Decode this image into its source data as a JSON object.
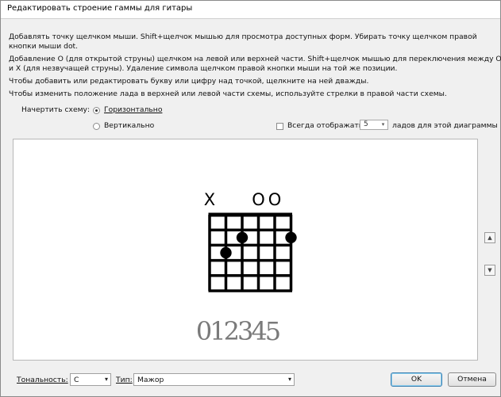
{
  "window": {
    "title": "Редактировать строение гаммы для гитары"
  },
  "instructions": [
    "Добавлять точку щелчком мыши. Shift+щелчок мышью для просмотра доступных форм. Убирать точку щелчком правой",
    "кнопки мыши dot.",
    "Добавление O (для открытой струны) щелчком на левой или верхней части. Shift+щелчок мышью для переключения между O",
    "и X (для незвучащей струны). Удаление символа щелчком правой кнопки мыши на той же позиции.",
    "Чтобы добавить или редактировать букву или цифру над точкой, щелкните на ней дважды.",
    "Чтобы изменить положение лада в верхней или левой части схемы, используйте стрелки в правой части схемы."
  ],
  "orientation": {
    "label": "Начертить схему:",
    "horizontal": "Горизонтально",
    "vertical": "Вертикально",
    "selected": "horizontal"
  },
  "always_show": {
    "label": "Всегда отображать",
    "value": "5",
    "suffix": "ладов для этой диаграммы",
    "checked": false
  },
  "diagram": {
    "string_markers": [
      "X",
      "",
      "",
      "O",
      "O",
      ""
    ],
    "dots": [
      {
        "string": 2,
        "fret": 3
      },
      {
        "string": 3,
        "fret": 2
      },
      {
        "string": 6,
        "fret": 2
      }
    ],
    "fret_count": 5,
    "fingering": "012345"
  },
  "side_buttons": {
    "up": "up-arrow",
    "down": "down-arrow"
  },
  "footer": {
    "key_label": "Тональность:",
    "key_value": "C",
    "type_label": "Тип:",
    "type_value": "Мажор",
    "ok": "OK",
    "cancel": "Отмена"
  }
}
